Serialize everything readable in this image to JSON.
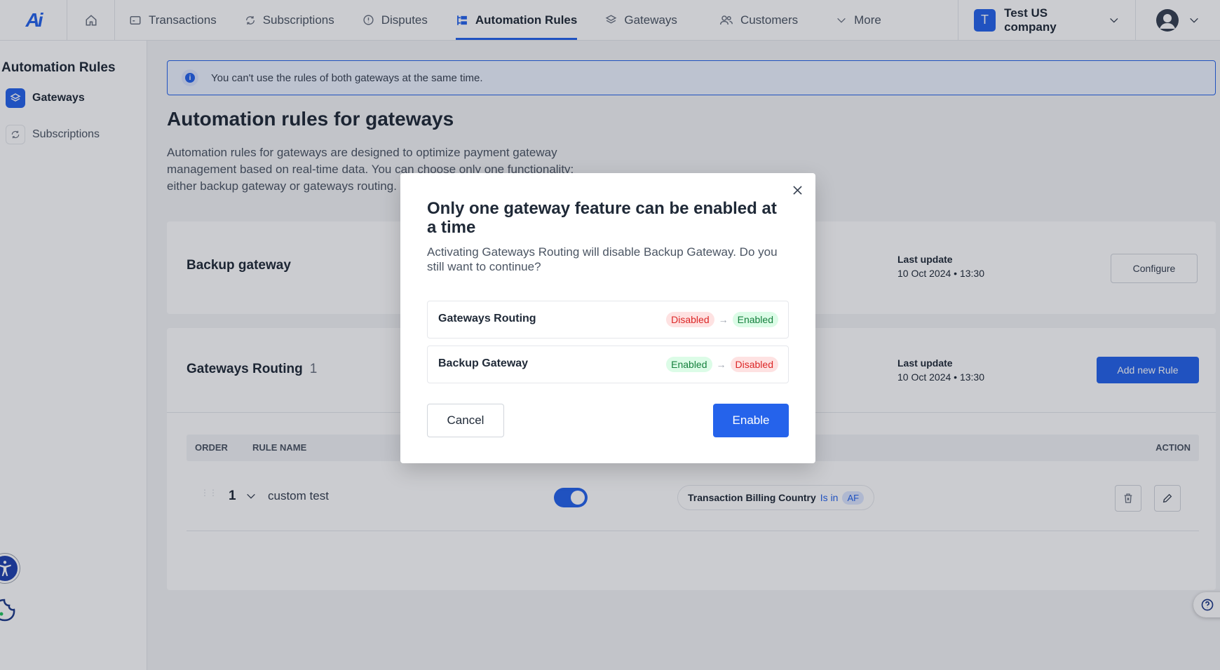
{
  "app": {
    "logo": "Ai"
  },
  "nav": {
    "items": [
      {
        "label": "Transactions",
        "icon": "transactions-icon"
      },
      {
        "label": "Subscriptions",
        "icon": "refresh-icon"
      },
      {
        "label": "Disputes",
        "icon": "alert-circle-icon"
      },
      {
        "label": "Automation Rules",
        "icon": "automation-icon",
        "active": true
      },
      {
        "label": "Gateways",
        "icon": "layers-icon"
      },
      {
        "label": "Customers",
        "icon": "users-icon"
      },
      {
        "label": "More",
        "icon": "chevron-down-icon"
      }
    ],
    "company_initial": "T",
    "company_name": "Test US company"
  },
  "sidebar": {
    "title": "Automation Rules",
    "items": [
      {
        "label": "Gateways",
        "active": true
      },
      {
        "label": "Subscriptions",
        "active": false
      }
    ]
  },
  "main": {
    "banner": "You can't use the rules of both gateways at the same time.",
    "title": "Automation rules for gateways",
    "description": "Automation rules for gateways are designed to optimize payment gateway management based on real-time data. You can choose only one functionality: either backup gateway or gateways routing.",
    "backup": {
      "title": "Backup gateway",
      "last_update_label": "Last update",
      "last_update_value": "10 Oct 2024 • 13:30",
      "button": "Configure"
    },
    "routing": {
      "title": "Gateways Routing",
      "count": "1",
      "last_update_label": "Last update",
      "last_update_value": "10 Oct 2024 • 13:30",
      "button": "Add new Rule",
      "columns": {
        "order": "ORDER",
        "rule_name": "RULE NAME",
        "action": "ACTION"
      },
      "rows": [
        {
          "order": "1",
          "name": "custom test",
          "enabled": true,
          "condition_field": "Transaction Billing Country",
          "condition_op": "Is in",
          "condition_value": "AF"
        }
      ]
    }
  },
  "modal": {
    "title": "Only one gateway feature can be enabled at a time",
    "description": "Activating Gateways Routing will disable Backup Gateway. Do you still want to continue?",
    "features": [
      {
        "name": "Gateways Routing",
        "from": "Disabled",
        "to": "Enabled"
      },
      {
        "name": "Backup Gateway",
        "from": "Enabled",
        "to": "Disabled"
      }
    ],
    "cancel": "Cancel",
    "confirm": "Enable"
  },
  "colors": {
    "primary": "#2563eb",
    "enabled": "#15803d",
    "disabled": "#dc2626"
  }
}
